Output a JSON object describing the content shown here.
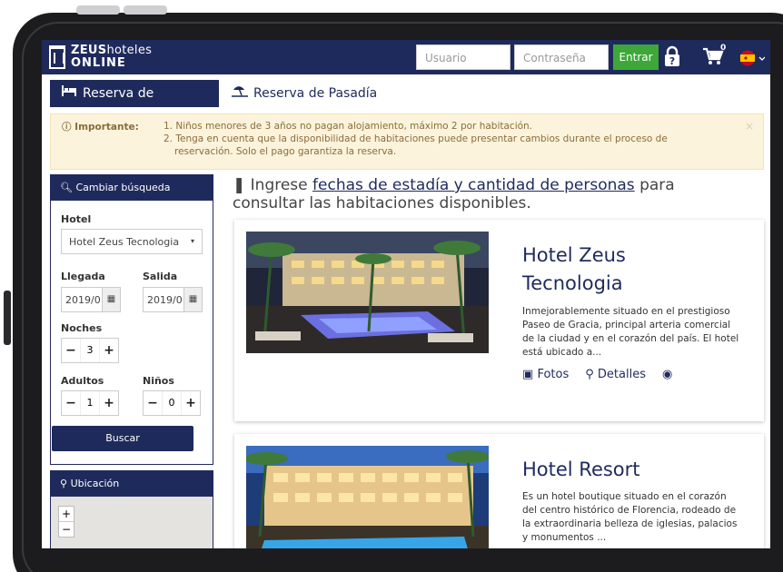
{
  "navbar": {
    "logo_line1_bold": "ZEUS",
    "logo_line1_rest": "hoteles",
    "logo_line2": "ONLINE",
    "user_placeholder": "Usuario",
    "password_placeholder": "Contraseña",
    "login_label": "Entrar",
    "cart_count": "0"
  },
  "tabs": [
    {
      "label": "Reserva de Habitación"
    },
    {
      "label": "Reserva de Pasadía"
    }
  ],
  "alert": {
    "title": "Importante:",
    "items": [
      "1. Niños menores de 3 años no pagan alojamiento, máximo 2 por habitación.",
      "2. Tenga en cuenta que la disponibilidad de habitaciones puede presentar cambios durante el proceso de reservación. Solo el pago garantiza la reserva."
    ],
    "close": "×"
  },
  "search": {
    "header": "Cambiar búsqueda",
    "hotel_label": "Hotel",
    "hotel_value": "Hotel Zeus Tecnologia",
    "arrival_label": "Llegada",
    "arrival_value": "2019/0",
    "departure_label": "Salida",
    "departure_value": "2019/0",
    "nights_label": "Noches",
    "nights_value": "3",
    "adults_label": "Adultos",
    "adults_value": "1",
    "children_label": "Niños",
    "children_value": "0",
    "search_button": "Buscar"
  },
  "location": {
    "header": "Ubicación",
    "zoom_in": "+",
    "zoom_out": "−"
  },
  "intro": {
    "before": "Ingrese ",
    "link": "fechas de estadía y cantidad de personas",
    "after": " para consultar las habitaciones disponibles."
  },
  "hotels": [
    {
      "name": "Hotel Zeus Tecnologia",
      "description": "Inmejorablemente situado en el prestigioso Paseo de Gracia, principal arteria comercial de la ciudad y en el corazón del país. El hotel está ubicado a...",
      "photos_label": "Fotos",
      "details_label": "Detalles"
    },
    {
      "name": "Hotel Resort",
      "description": "Es un hotel boutique situado en el corazón del centro histórico de Florencia, rodeado de la extraordinaria belleza de iglesias, palacios y monumentos ..."
    }
  ]
}
